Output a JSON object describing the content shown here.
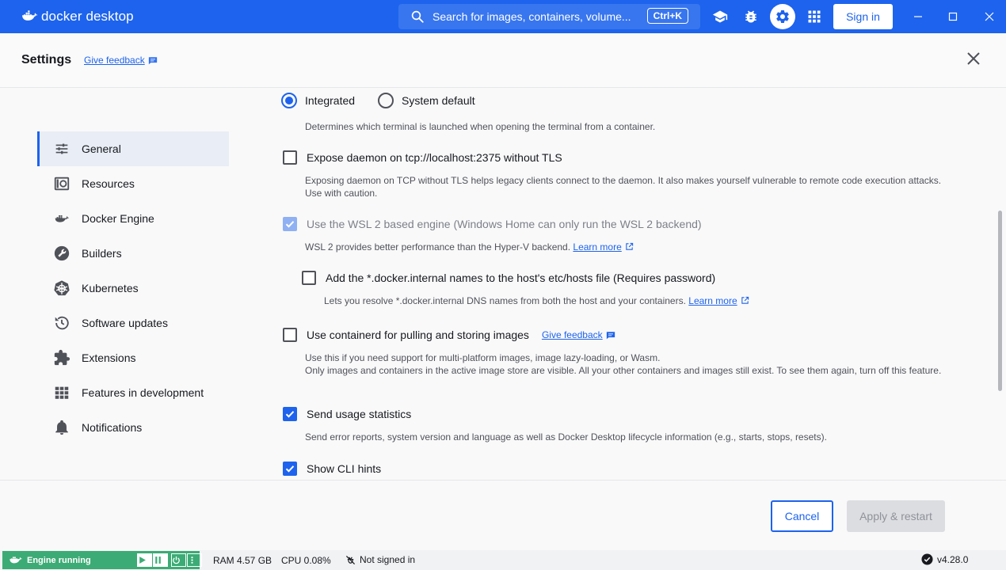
{
  "titlebar": {
    "brand": "docker desktop",
    "search_placeholder": "Search for images, containers, volume...",
    "search_shortcut": "Ctrl+K",
    "sign_in": "Sign in"
  },
  "header": {
    "title": "Settings",
    "feedback": "Give feedback"
  },
  "sidebar": {
    "items": [
      {
        "label": "General",
        "icon": "sliders-icon",
        "active": true
      },
      {
        "label": "Resources",
        "icon": "resources-icon"
      },
      {
        "label": "Docker Engine",
        "icon": "engine-icon"
      },
      {
        "label": "Builders",
        "icon": "wrench-icon"
      },
      {
        "label": "Kubernetes",
        "icon": "helm-icon"
      },
      {
        "label": "Software updates",
        "icon": "history-icon"
      },
      {
        "label": "Extensions",
        "icon": "puzzle-icon"
      },
      {
        "label": "Features in development",
        "icon": "grid-icon"
      },
      {
        "label": "Notifications",
        "icon": "bell-icon"
      }
    ]
  },
  "settings": {
    "terminal": {
      "option_integrated": "Integrated",
      "option_system": "System default",
      "selected": "Integrated",
      "desc": "Determines which terminal is launched when opening the terminal from a container."
    },
    "expose_daemon": {
      "label": "Expose daemon on tcp://localhost:2375 without TLS",
      "checked": false,
      "desc": "Exposing daemon on TCP without TLS helps legacy clients connect to the daemon. It also makes yourself vulnerable to remote code execution attacks. Use with caution."
    },
    "wsl2": {
      "label": "Use the WSL 2 based engine (Windows Home can only run the WSL 2 backend)",
      "checked": true,
      "disabled": true,
      "desc": "WSL 2 provides better performance than the Hyper-V backend.",
      "link": "Learn more"
    },
    "hosts": {
      "label": "Add the *.docker.internal names to the host's etc/hosts file (Requires password)",
      "checked": false,
      "desc": "Lets you resolve *.docker.internal DNS names from both the host and your containers.",
      "link": "Learn more"
    },
    "containerd": {
      "label": "Use containerd for pulling and storing images",
      "checked": false,
      "feedback": "Give feedback",
      "desc1": "Use this if you need support for multi-platform images, image lazy-loading, or Wasm.",
      "desc2": "Only images and containers in the active image store are visible. All your other containers and images still exist. To see them again, turn off this feature."
    },
    "usage_stats": {
      "label": "Send usage statistics",
      "checked": true,
      "desc": "Send error reports, system version and language as well as Docker Desktop lifecycle information (e.g., starts, stops, resets)."
    },
    "cli_hints": {
      "label": "Show CLI hints",
      "checked": true
    }
  },
  "footer": {
    "cancel": "Cancel",
    "apply": "Apply & restart"
  },
  "statusbar": {
    "engine": "Engine running",
    "ram": "RAM 4.57 GB",
    "cpu": "CPU 0.08%",
    "signed": "Not signed in",
    "version": "v4.28.0"
  },
  "colors": {
    "accent": "#1d63ed",
    "engine_green": "#3cab75"
  }
}
